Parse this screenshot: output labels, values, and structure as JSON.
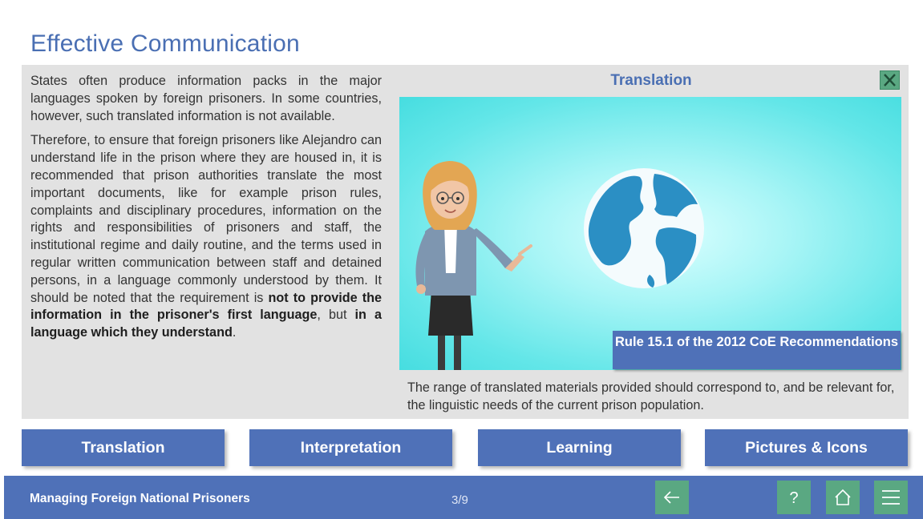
{
  "page": {
    "title": "Effective Communication"
  },
  "body_text": {
    "para1": "States often produce information packs in the major languages spoken by foreign prisoners. In some countries, however, such translated information is not available.",
    "para2_start": "Therefore, to ensure that foreign prisoners like Alejandro can understand life in the prison where they are housed in, it is recommended that prison authorities translate the most important documents, like for example prison rules, complaints and disciplinary procedures, information on the rights and responsibilities of prisoners and staff, the institutional regime and daily routine, and the terms used in regular written communication between staff and detained persons, in a language commonly understood by them. It should be noted that the requirement is ",
    "para2_bold1": "not to provide the information in the prisoner's first language",
    "para2_mid": ", but ",
    "para2_bold2": "in a language which they understand",
    "para2_end": "."
  },
  "popup": {
    "title": "Translation",
    "close_icon": "close-x-icon",
    "rule_label": "Rule 15.1 of the 2012 CoE Recommendations",
    "caption": "The range of translated materials provided should correspond to, and be relevant for, the linguistic needs of the current prison population."
  },
  "tabs": [
    {
      "label": "Translation"
    },
    {
      "label": "Interpretation"
    },
    {
      "label": "Learning"
    },
    {
      "label": "Pictures & Icons"
    }
  ],
  "footer": {
    "course_title": "Managing Foreign National Prisoners",
    "page_indicator": "3/9",
    "back_icon": "arrow-left-icon",
    "help_icon": "question-mark-icon",
    "home_icon": "home-icon",
    "menu_icon": "hamburger-menu-icon"
  },
  "colors": {
    "accent_blue": "#4f71b8",
    "title_blue": "#4a6fb3",
    "nav_green": "#5aa882",
    "panel_grey": "#e2e2e2",
    "video_cyan": "#63e6e8"
  }
}
